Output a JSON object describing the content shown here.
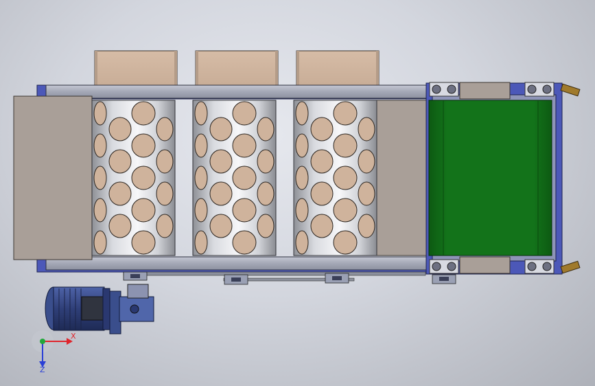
{
  "triad": {
    "x_label": "X",
    "z_label": "Z",
    "x_color": "#e0242b",
    "y_color": "#23a83a",
    "z_color": "#2a3fd6"
  },
  "colors": {
    "belt": "#116b17",
    "belt_dark": "#0b4f10",
    "frame_blue": "#4c58b8",
    "frame_rail": "#aeb2c2",
    "panel_tan": "#d9bfa8",
    "tray": "#a99f98",
    "hole": "#cfb39c",
    "motor": "#3a4e8c"
  },
  "assembly": {
    "drum_count": 3,
    "hole_columns_per_drum": 4,
    "hopper_count": 3
  }
}
